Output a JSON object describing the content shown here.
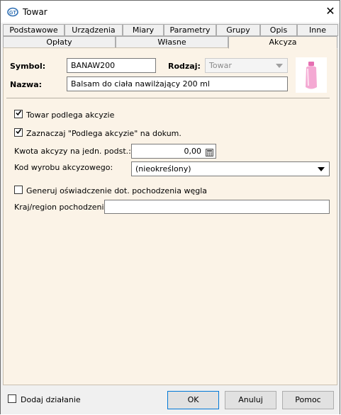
{
  "window": {
    "title": "Towar",
    "close": "✕"
  },
  "tabs_row1": [
    {
      "label": "Podstawowe"
    },
    {
      "label": "Urządzenia"
    },
    {
      "label": "Miary"
    },
    {
      "label": "Parametry"
    },
    {
      "label": "Grupy"
    },
    {
      "label": "Opis"
    },
    {
      "label": "Inne"
    }
  ],
  "tabs_row2": [
    {
      "label": "Opłaty"
    },
    {
      "label": "Własne"
    },
    {
      "label": "Akcyza",
      "active": true
    }
  ],
  "header": {
    "symbol_label": "Symbol:",
    "symbol_value": "BANAW200",
    "rodzaj_label": "Rodzaj:",
    "rodzaj_value": "Towar",
    "nazwa_label": "Nazwa:",
    "nazwa_value": "Balsam do ciała nawilżający 200 ml"
  },
  "excise": {
    "subject_label": "Towar podlega akcyzie",
    "subject_checked": true,
    "mark_label": "Zaznaczaj \"Podlega akcyzie\" na dokum.",
    "mark_checked": true,
    "amount_label": "Kwota akcyzy na jedn. podst.:",
    "amount_value": "0,00",
    "code_label": "Kod wyrobu akcyzowego:",
    "code_value": "(nieokreślony)",
    "coal_label": "Generuj oświadczenie dot. pochodzenia węgla",
    "coal_checked": false,
    "origin_label": "Kraj/region pochodzenia:",
    "origin_value": ""
  },
  "footer": {
    "add_action_label": "Dodaj działanie",
    "add_action_checked": false,
    "ok": "OK",
    "cancel": "Anuluj",
    "help": "Pomoc"
  },
  "colors": {
    "panel": "#fbf3e7",
    "accent": "#0078d7"
  }
}
